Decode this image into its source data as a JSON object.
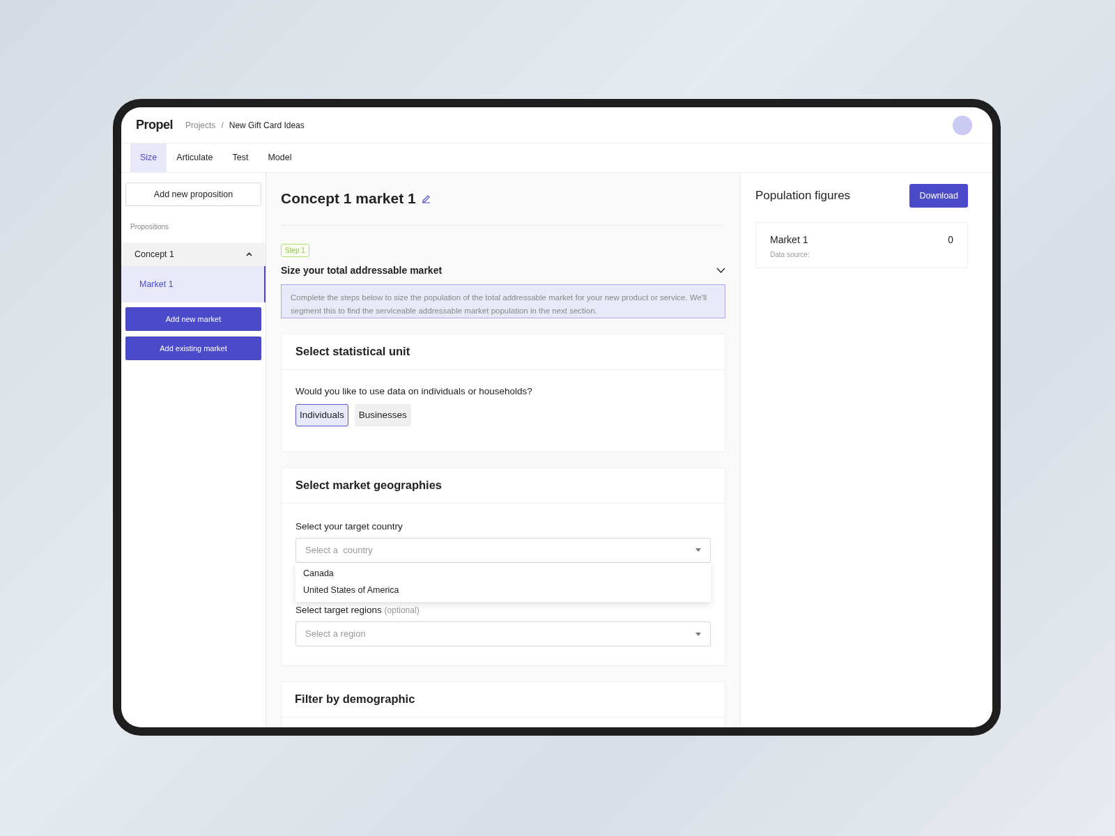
{
  "header": {
    "logo": "Propel",
    "breadcrumb": [
      {
        "label": "Projects"
      },
      {
        "label": "New Gift Card Ideas"
      }
    ],
    "separator": "/"
  },
  "tabs": [
    {
      "label": "Size",
      "selected": true
    },
    {
      "label": "Articulate",
      "selected": false
    },
    {
      "label": "Test",
      "selected": false
    },
    {
      "label": "Model",
      "selected": false
    }
  ],
  "sidebar": {
    "add_proposition": "Add new proposition",
    "section_label": "Propositions",
    "propositions": [
      {
        "label": "Concept 1",
        "expanded": true,
        "children": [
          {
            "label": "Market 1",
            "selected": true
          }
        ]
      }
    ],
    "buttons": [
      "Add new market",
      "Add existing market"
    ]
  },
  "main": {
    "title": "Concept 1 market 1",
    "step": {
      "badge": "Step 1",
      "heading": "Size your total addressable market",
      "expanded": true,
      "description": "Complete the steps below to size the population of the total addressable market for your new product or service. We'll segment this to find the serviceable addressable market population in the next section."
    },
    "unit_card": {
      "title": "Select statistical unit",
      "question": "Would you like to use data on individuals or households?",
      "options": [
        {
          "label": "Individuals",
          "selected": true
        },
        {
          "label": "Businesses",
          "selected": false
        }
      ]
    },
    "geo_card": {
      "title": "Select market geographies",
      "country_label": "Select your target country",
      "country_select": {
        "placeholder": "Select a  country",
        "expanded": true,
        "options": [
          {
            "label": "Canada"
          },
          {
            "label": "United States of America"
          }
        ]
      },
      "region_label": "Select target regions",
      "region_hint": "(optional)",
      "region_select": {
        "placeholder": "Select a region"
      }
    },
    "demographic_card": {
      "title": "Filter by demographic"
    }
  },
  "population_panel": {
    "title": "Population figures",
    "download": "Download",
    "markets": [
      {
        "name": "Market 1",
        "value": "0",
        "source_label": "Data source:"
      }
    ]
  }
}
